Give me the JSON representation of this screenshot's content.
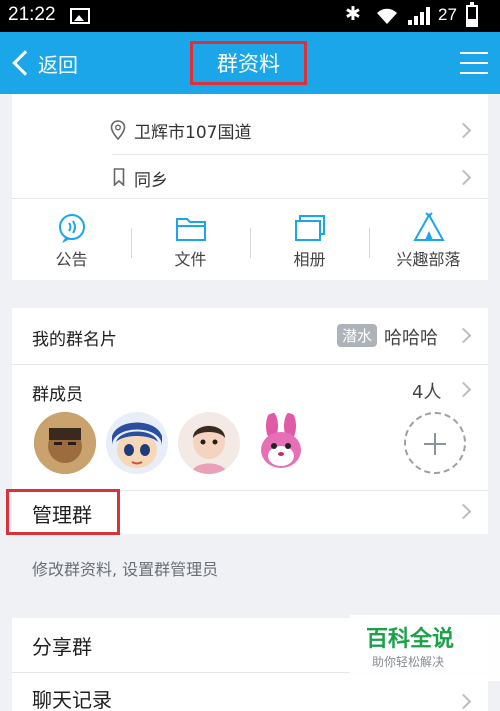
{
  "status_bar": {
    "time": "21:22",
    "battery": "27"
  },
  "nav": {
    "back_label": "返回",
    "title": "群资料"
  },
  "info_rows": {
    "location": "卫辉市107国道",
    "tag": "同乡"
  },
  "quick_actions": [
    {
      "label": "公告",
      "icon": "announcement-icon"
    },
    {
      "label": "文件",
      "icon": "folder-icon"
    },
    {
      "label": "相册",
      "icon": "album-icon"
    },
    {
      "label": "兴趣部落",
      "icon": "tribe-icon"
    }
  ],
  "my_card": {
    "label": "我的群名片",
    "badge": "潜水",
    "nickname": "哈哈哈"
  },
  "members": {
    "label": "群成员",
    "count": "4人"
  },
  "manage": {
    "label": "管理群",
    "hint": "修改群资料, 设置群管理员"
  },
  "share": {
    "label": "分享群"
  },
  "history": {
    "label": "聊天记录"
  },
  "watermark": {
    "title": "百科全说",
    "subtitle": "助你轻松解决"
  },
  "colors": {
    "accent": "#1aa6e9",
    "highlight": "#d8333b",
    "watermark_green": "#1aa14a"
  }
}
